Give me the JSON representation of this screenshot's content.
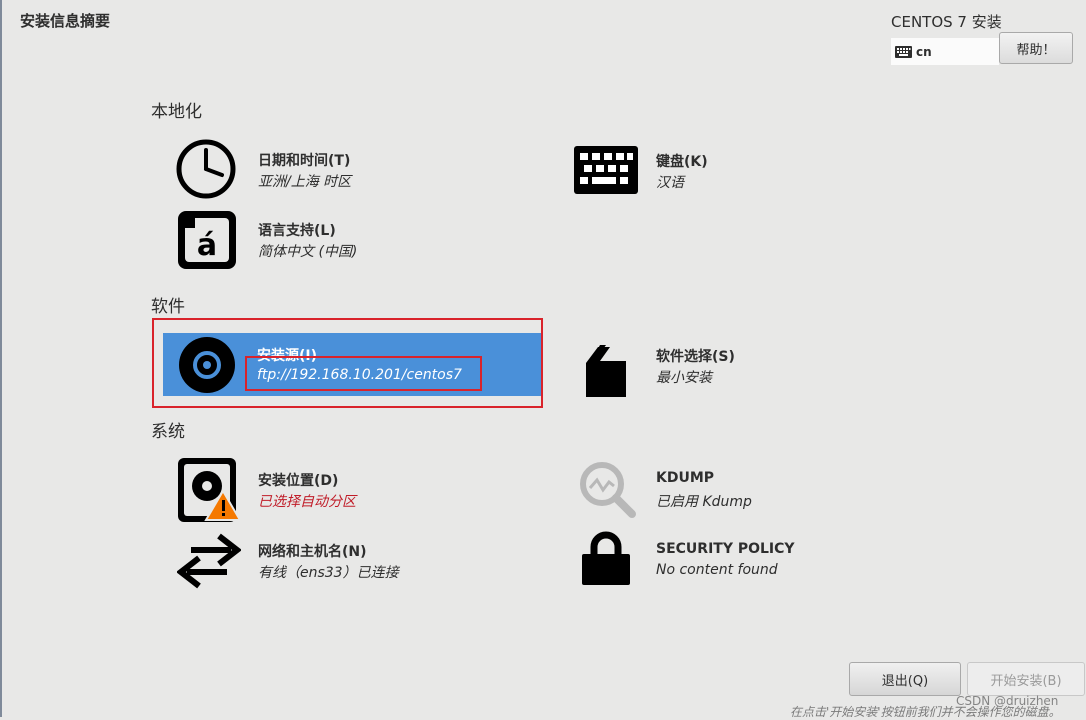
{
  "header": {
    "page_title": "安装信息摘要",
    "product_title": "CENTOS 7 安装",
    "keyboard_layout": "cn",
    "help_label": "帮助！"
  },
  "sections": {
    "localization": {
      "title": "本地化",
      "date_time": {
        "title": "日期和时间(T)",
        "status": "亚洲/上海 时区",
        "icon": "clock-icon"
      },
      "keyboard": {
        "title": "键盘(K)",
        "status": "汉语",
        "icon": "keyboard-icon"
      },
      "language": {
        "title": "语言支持(L)",
        "status": "简体中文 (中国)",
        "icon": "language-icon"
      }
    },
    "software": {
      "title": "软件",
      "install_source": {
        "title": "安装源(I)",
        "status": "ftp://192.168.10.201/centos7",
        "icon": "disc-icon"
      },
      "software_selection": {
        "title": "软件选择(S)",
        "status": "最小安装",
        "icon": "package-icon"
      }
    },
    "system": {
      "title": "系统",
      "install_destination": {
        "title": "安装位置(D)",
        "status": "已选择自动分区",
        "icon": "harddisk-icon"
      },
      "kdump": {
        "title": "KDUMP",
        "status": "已启用 Kdump",
        "icon": "kdump-search-icon"
      },
      "network": {
        "title": "网络和主机名(N)",
        "status": "有线（ens33）已连接",
        "icon": "network-arrows-icon"
      },
      "security": {
        "title": "SECURITY POLICY",
        "status": "No content found",
        "icon": "lock-icon"
      }
    }
  },
  "footer": {
    "quit_label": "退出(Q)",
    "begin_label": "开始安装(B)",
    "note": "在点击'开始安装'按钮前我们并不会操作您的磁盘。",
    "watermark": "CSDN @druizhen"
  },
  "colors": {
    "selected_spoke": "#4a90d9",
    "warning_text": "#c01c28",
    "highlight_box": "#d9232b",
    "background": "#e8e8e7"
  }
}
